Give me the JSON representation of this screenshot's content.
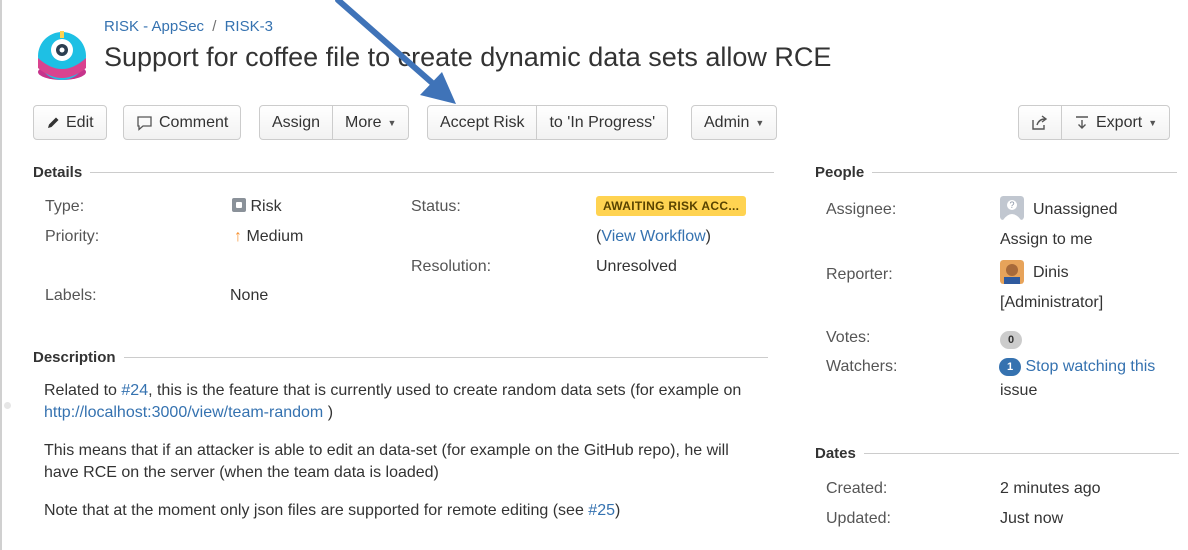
{
  "breadcrumb": {
    "project": "RISK - AppSec",
    "separator": "/",
    "issue_key": "RISK-3"
  },
  "issue": {
    "summary": "Support for coffee file to create dynamic data sets allow RCE"
  },
  "toolbar": {
    "edit": "Edit",
    "comment": "Comment",
    "assign": "Assign",
    "more": "More",
    "accept_risk": "Accept Risk",
    "in_progress": "to 'In Progress'",
    "admin": "Admin",
    "export": "Export"
  },
  "details": {
    "heading": "Details",
    "type_label": "Type:",
    "type_value": "Risk",
    "priority_label": "Priority:",
    "priority_value": "Medium",
    "labels_label": "Labels:",
    "labels_value": "None",
    "status_label": "Status:",
    "status_value": "AWAITING RISK ACC...",
    "workflow_open": "(",
    "workflow_link": "View Workflow",
    "workflow_close": ")",
    "resolution_label": "Resolution:",
    "resolution_value": "Unresolved"
  },
  "description": {
    "heading": "Description",
    "p1_a": "Related to ",
    "p1_link1": "#24",
    "p1_b": ", this is the feature that is currently used to create random data sets (for example on ",
    "p1_link2": "http://localhost:3000/view/team-random",
    "p1_c": " )",
    "p2": "This means that if an attacker is able to edit an data-set (for example on the GitHub repo), he will have RCE on the server (when the team data is loaded)",
    "p3_a": "Note that at the moment only json files are supported for remote editing (see ",
    "p3_link": "#25",
    "p3_b": ")"
  },
  "people": {
    "heading": "People",
    "assignee_label": "Assignee:",
    "assignee_value": "Unassigned",
    "assign_to_me": "Assign to me",
    "reporter_label": "Reporter:",
    "reporter_name": "Dinis",
    "reporter_role": "[Administrator]",
    "votes_label": "Votes:",
    "votes_count": "0",
    "watchers_label": "Watchers:",
    "watchers_count": "1",
    "watch_link_1": "Stop watching this",
    "watch_link_2": "issue"
  },
  "dates": {
    "heading": "Dates",
    "created_label": "Created:",
    "created_value": "2 minutes ago",
    "updated_label": "Updated:",
    "updated_value": "Just now"
  },
  "colors": {
    "link": "#3572b0",
    "lozenge": "#ffd351",
    "annotation_arrow": "#3f73b8",
    "priority": "#f79232"
  },
  "icons": {
    "project_avatar": "robot-avatar-icon",
    "edit": "pencil-icon",
    "comment": "speech-bubble-icon",
    "share": "share-icon",
    "export": "download-icon",
    "type": "risk-icon",
    "priority": "arrow-up-icon"
  }
}
